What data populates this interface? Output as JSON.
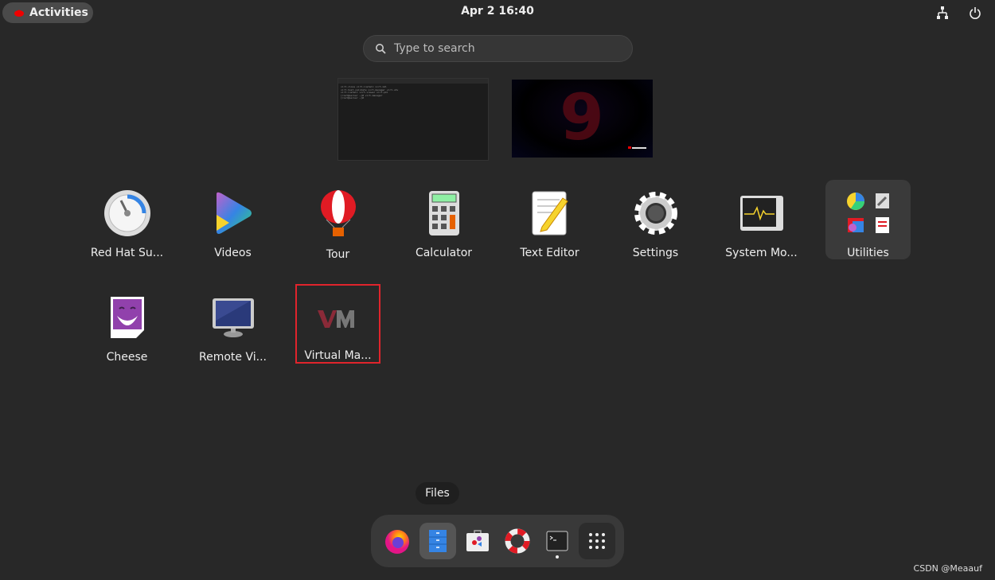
{
  "topbar": {
    "activities_label": "Activities",
    "clock": "Apr 2  16:40",
    "network_icon": "network-wired-icon",
    "power_icon": "power-icon"
  },
  "search": {
    "placeholder": "Type to search"
  },
  "workspaces": [
    {
      "name": "terminal-window"
    },
    {
      "name": "desktop-wallpaper"
    }
  ],
  "apps": [
    {
      "label": "Red Hat Su...",
      "icon": "red-hat-subscription-icon"
    },
    {
      "label": "Videos",
      "icon": "videos-icon"
    },
    {
      "label": "Tour",
      "icon": "tour-balloon-icon"
    },
    {
      "label": "Calculator",
      "icon": "calculator-icon"
    },
    {
      "label": "Text Editor",
      "icon": "text-editor-icon"
    },
    {
      "label": "Settings",
      "icon": "settings-gear-icon"
    },
    {
      "label": "System Mo...",
      "icon": "system-monitor-icon"
    },
    {
      "label": "Utilities",
      "icon": "utilities-folder-icon"
    },
    {
      "label": "Cheese",
      "icon": "cheese-icon"
    },
    {
      "label": "Remote Vi...",
      "icon": "remote-viewer-icon"
    },
    {
      "label": "Virtual Ma...",
      "icon": "virt-manager-icon"
    }
  ],
  "dock": {
    "tooltip": "Files",
    "items": [
      "firefox",
      "files",
      "software",
      "help",
      "terminal",
      "show-apps"
    ]
  },
  "watermark": "CSDN @Meaauf",
  "colors": {
    "accent_red": "#e0242c",
    "background": "#282828"
  }
}
